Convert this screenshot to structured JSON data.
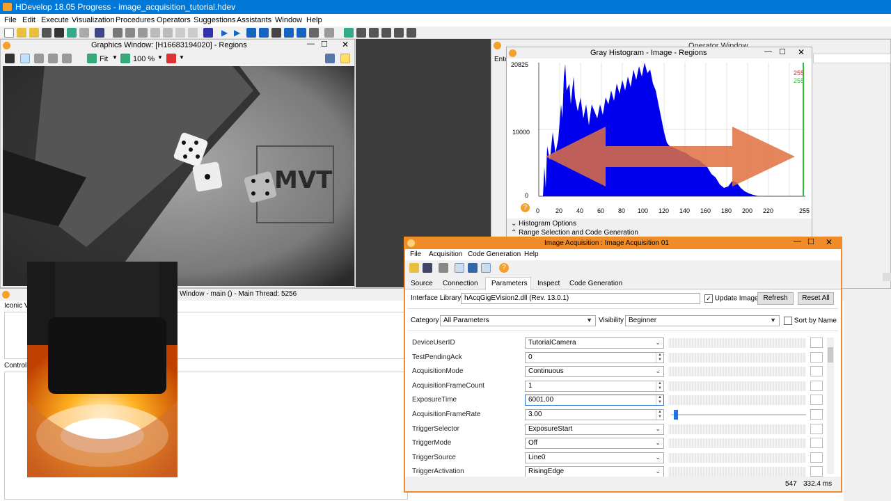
{
  "app": {
    "title": "HDevelop 18.05 Progress - image_acquisition_tutorial.hdev",
    "menu": [
      "File",
      "Edit",
      "Execute",
      "Visualization",
      "Procedures",
      "Operators",
      "Suggestions",
      "Assistants",
      "Window",
      "Help"
    ]
  },
  "graphics_window": {
    "title": "Graphics Window: [H16683194020] - Regions",
    "zoom_fit": "Fit",
    "zoom_percent": "100 %"
  },
  "operator_window": {
    "title": "Operator Window",
    "enter_label": "Ente"
  },
  "variable_window": {
    "title": "Window - main () - Main Thread: 5256",
    "iconic_label": "Iconic V",
    "control_label": "Control"
  },
  "histogram": {
    "title": "Gray Histogram - Image - Regions",
    "y_top": "20825",
    "y_mid": "10000",
    "y_bottom": "0",
    "x_ticks": [
      "0",
      "20",
      "40",
      "60",
      "80",
      "100",
      "120",
      "140",
      "160",
      "180",
      "200",
      "220",
      "255"
    ],
    "range_low": "255",
    "range_high": "255",
    "range_low_color": "#e02020",
    "range_high_color": "#30c030",
    "options_label": "Histogram Options",
    "range_label": "Range Selection and Code Generation"
  },
  "acquisition": {
    "title": "Image Acquisition : Image Acquisition 01",
    "menu": [
      "File",
      "Acquisition",
      "Code Generation",
      "Help"
    ],
    "tabs": [
      "Source",
      "Connection",
      "Parameters",
      "Inspect",
      "Code Generation"
    ],
    "active_tab": "Parameters",
    "interface_library_label": "Interface Library",
    "interface_library_value": "hAcqGigEVision2.dll (Rev. 13.0.1)",
    "update_image_label": "Update Image",
    "refresh_label": "Refresh",
    "reset_all_label": "Reset All",
    "category_label": "Category",
    "category_value": "All Parameters",
    "visibility_label": "Visibility",
    "visibility_value": "Beginner",
    "sort_by_name_label": "Sort by Name",
    "params": [
      {
        "name": "DeviceUserID",
        "value": "TutorialCamera",
        "kind": "combo"
      },
      {
        "name": "TestPendingAck",
        "value": "0",
        "kind": "spin"
      },
      {
        "name": "AcquisitionMode",
        "value": "Continuous",
        "kind": "combo"
      },
      {
        "name": "AcquisitionFrameCount",
        "value": "1",
        "kind": "spin"
      },
      {
        "name": "ExposureTime",
        "value": "6001.00",
        "kind": "spin"
      },
      {
        "name": "AcquisitionFrameRate",
        "value": "3.00",
        "kind": "spin"
      },
      {
        "name": "TriggerSelector",
        "value": "ExposureStart",
        "kind": "combo"
      },
      {
        "name": "TriggerMode",
        "value": "Off",
        "kind": "combo"
      },
      {
        "name": "TriggerSource",
        "value": "Line0",
        "kind": "combo"
      },
      {
        "name": "TriggerActivation",
        "value": "RisingEdge",
        "kind": "combo"
      }
    ],
    "status_count": "547",
    "status_time": "332.4 ms"
  }
}
